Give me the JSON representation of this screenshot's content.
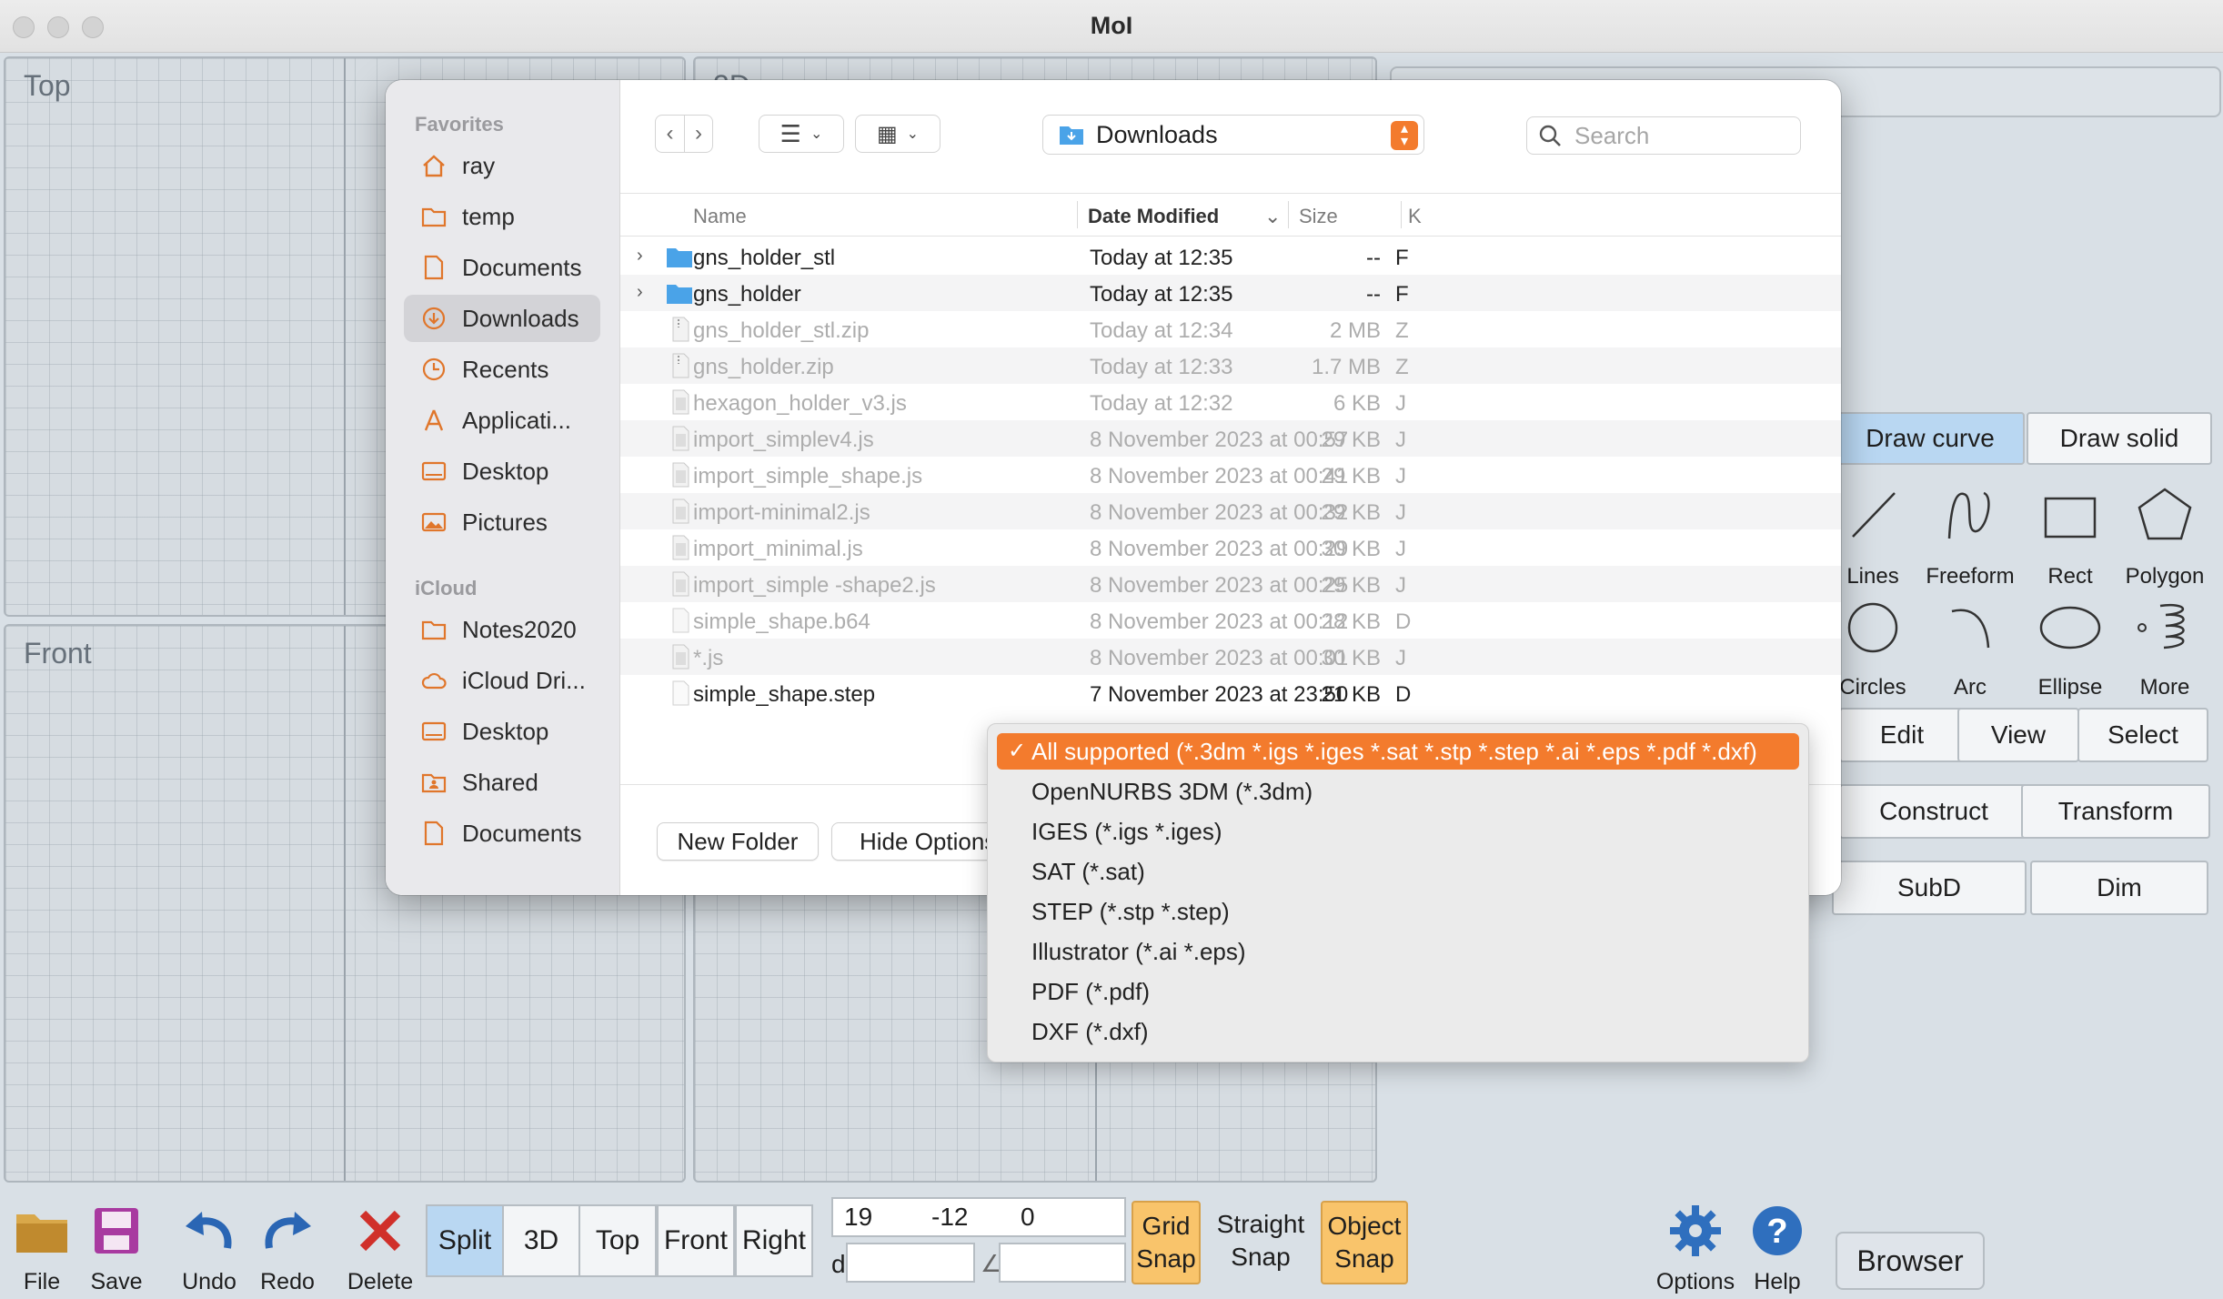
{
  "window": {
    "title": "MoI"
  },
  "viewports": {
    "top": "Top",
    "threed": "3D",
    "front": "Front"
  },
  "palette": {
    "tabs": {
      "draw_curve": "Draw curve",
      "draw_solid": "Draw solid"
    },
    "tools": {
      "lines": "Lines",
      "freeform": "Freeform",
      "rect": "Rect",
      "polygon": "Polygon",
      "circles": "Circles",
      "arc": "Arc",
      "ellipse": "Ellipse",
      "more": "More"
    },
    "buttons": {
      "edit": "Edit",
      "view": "View",
      "select": "Select",
      "construct": "Construct",
      "transform": "Transform",
      "subd": "SubD",
      "dim": "Dim"
    }
  },
  "toolbar": {
    "file": "File",
    "save": "Save",
    "undo": "Undo",
    "redo": "Redo",
    "delete": "Delete",
    "views": {
      "split": "Split",
      "threed": "3D",
      "top": "Top",
      "front": "Front",
      "right": "Right"
    },
    "coords": {
      "x": "19",
      "y": "-12",
      "z": "0",
      "d_label": "d",
      "angle_label": "∠"
    },
    "snaps": {
      "grid_1": "Grid",
      "grid_2": "Snap",
      "straight_1": "Straight",
      "straight_2": "Snap",
      "object_1": "Object",
      "object_2": "Snap"
    },
    "options": "Options",
    "help": "Help",
    "browser": "Browser"
  },
  "dialog": {
    "sidebar": {
      "favorites_header": "Favorites",
      "favorites": [
        "ray",
        "temp",
        "Documents",
        "Downloads",
        "Recents",
        "Applicati...",
        "Desktop",
        "Pictures"
      ],
      "icloud_header": "iCloud",
      "icloud": [
        "Notes2020",
        "iCloud Dri...",
        "Desktop",
        "Shared",
        "Documents"
      ]
    },
    "location": "Downloads",
    "search_placeholder": "Search",
    "columns": {
      "name": "Name",
      "date": "Date Modified",
      "size": "Size",
      "kind": "K"
    },
    "files": [
      {
        "name": "gns_holder_stl",
        "date": "Today at 12:35",
        "size": "--",
        "kind": "F"
      },
      {
        "name": "gns_holder",
        "date": "Today at 12:35",
        "size": "--",
        "kind": "F"
      },
      {
        "name": "gns_holder_stl.zip",
        "date": "Today at 12:34",
        "size": "2 MB",
        "kind": "Z"
      },
      {
        "name": "gns_holder.zip",
        "date": "Today at 12:33",
        "size": "1.7 MB",
        "kind": "Z"
      },
      {
        "name": "hexagon_holder_v3.js",
        "date": "Today at 12:32",
        "size": "6 KB",
        "kind": "J"
      },
      {
        "name": "import_simplev4.js",
        "date": "8 November 2023 at 00:57",
        "size": "29 KB",
        "kind": "J"
      },
      {
        "name": "import_simple_shape.js",
        "date": "8 November 2023 at 00:41",
        "size": "29 KB",
        "kind": "J"
      },
      {
        "name": "import-minimal2.js",
        "date": "8 November 2023 at 00:32",
        "size": "29 KB",
        "kind": "J"
      },
      {
        "name": "import_minimal.js",
        "date": "8 November 2023 at 00:29",
        "size": "30 KB",
        "kind": "J"
      },
      {
        "name": "import_simple -shape2.js",
        "date": "8 November 2023 at 00:25",
        "size": "29 KB",
        "kind": "J"
      },
      {
        "name": "simple_shape.b64",
        "date": "8 November 2023 at 00:12",
        "size": "28 KB",
        "kind": "D"
      },
      {
        "name": "*.js",
        "date": "8 November 2023 at 00:01",
        "size": "30 KB",
        "kind": "J"
      },
      {
        "name": "simple_shape.step",
        "date": "7 November 2023 at 23:50",
        "size": "21 KB",
        "kind": "D"
      }
    ],
    "new_folder": "New Folder",
    "hide_options": "Hide Options"
  },
  "file_type_menu": {
    "items": [
      "All supported (*.3dm *.igs *.iges *.sat *.stp *.step *.ai *.eps *.pdf *.dxf)",
      "OpenNURBS 3DM (*.3dm)",
      "IGES (*.igs *.iges)",
      "SAT (*.sat)",
      "STEP (*.stp *.step)",
      "Illustrator (*.ai *.eps)",
      "PDF (*.pdf)",
      "DXF (*.dxf)"
    ],
    "selected_index": 0
  },
  "colors": {
    "accent": "#f37b2d",
    "folder_blue": "#4aa3e8",
    "snap_on": "#f9c46b",
    "active_view": "#b9d7f2"
  }
}
